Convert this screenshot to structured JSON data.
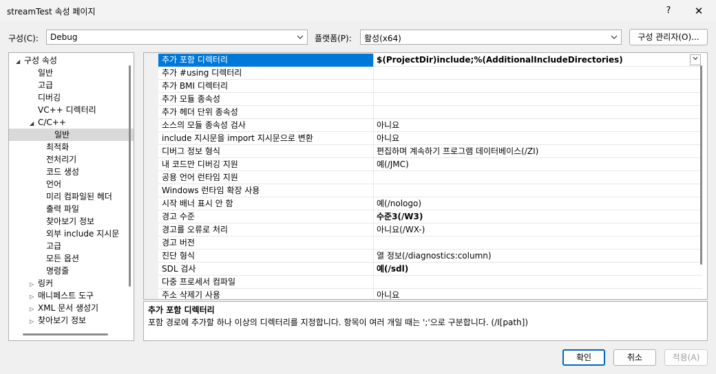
{
  "window": {
    "title": "streamTest 속성 페이지",
    "help": "?",
    "close": "✕"
  },
  "toolbar": {
    "config_label": "구성(C):",
    "config_value": "Debug",
    "platform_label": "플랫폼(P):",
    "platform_value": "활성(x64)",
    "config_manager": "구성 관리자(O)..."
  },
  "tree": [
    {
      "label": "구성 속성",
      "level": 0,
      "toggle": "expanded"
    },
    {
      "label": "일반",
      "level": 1
    },
    {
      "label": "고급",
      "level": 1
    },
    {
      "label": "디버깅",
      "level": 1
    },
    {
      "label": "VC++ 디렉터리",
      "level": 1
    },
    {
      "label": "C/C++",
      "level": 1,
      "toggle": "expanded"
    },
    {
      "label": "일반",
      "level": 2,
      "selected": true
    },
    {
      "label": "최적화",
      "level": 2
    },
    {
      "label": "전처리기",
      "level": 2
    },
    {
      "label": "코드 생성",
      "level": 2
    },
    {
      "label": "언어",
      "level": 2
    },
    {
      "label": "미리 컴파일된 헤더",
      "level": 2
    },
    {
      "label": "출력 파일",
      "level": 2
    },
    {
      "label": "찾아보기 정보",
      "level": 2
    },
    {
      "label": "외부 include 지시문",
      "level": 2
    },
    {
      "label": "고급",
      "level": 2
    },
    {
      "label": "모든 옵션",
      "level": 2
    },
    {
      "label": "명령줄",
      "level": 2
    },
    {
      "label": "링커",
      "level": 1,
      "toggle": "collapsed"
    },
    {
      "label": "매니페스트 도구",
      "level": 1,
      "toggle": "collapsed"
    },
    {
      "label": "XML 문서 생성기",
      "level": 1,
      "toggle": "collapsed"
    },
    {
      "label": "찾아보기 정보",
      "level": 1,
      "toggle": "collapsed"
    }
  ],
  "properties": [
    {
      "name": "추가 포함 디렉터리",
      "value": "$(ProjectDir)include;%(AdditionalIncludeDirectories)",
      "bold": true,
      "selected": true
    },
    {
      "name": "추가 #using 디렉터리",
      "value": ""
    },
    {
      "name": "추가 BMI 디렉터리",
      "value": ""
    },
    {
      "name": "추가 모듈 종속성",
      "value": ""
    },
    {
      "name": "추가 헤더 단위 종속성",
      "value": ""
    },
    {
      "name": "소스의 모듈 종속성 검사",
      "value": "아니요"
    },
    {
      "name": "include 지시문을 import 지시문으로 변환",
      "value": "아니요"
    },
    {
      "name": "디버그 정보 형식",
      "value": "편집하며 계속하기 프로그램 데이터베이스(/ZI)"
    },
    {
      "name": "내 코드만 디버깅 지원",
      "value": "예(/JMC)"
    },
    {
      "name": "공용 언어 런타임 지원",
      "value": ""
    },
    {
      "name": "Windows 런타임 확장 사용",
      "value": ""
    },
    {
      "name": "시작 배너 표시 안 함",
      "value": "예(/nologo)"
    },
    {
      "name": "경고 수준",
      "value": "수준3(/W3)",
      "bold": true
    },
    {
      "name": "경고를 오류로 처리",
      "value": "아니요(/WX-)"
    },
    {
      "name": "경고 버전",
      "value": ""
    },
    {
      "name": "진단 형식",
      "value": "열 정보(/diagnostics:column)"
    },
    {
      "name": "SDL 검사",
      "value": "예(/sdl)",
      "bold": true
    },
    {
      "name": "다중 프로세서 컴파일",
      "value": ""
    },
    {
      "name": "주소 삭제기 사용",
      "value": "아니요"
    }
  ],
  "description": {
    "title": "추가 포함 디렉터리",
    "text": "포함 경로에 추가할 하나 이상의 디렉터리를 지정합니다. 항목이 여러 개일 때는 ';'으로 구분합니다. (/I[path])"
  },
  "buttons": {
    "ok": "확인",
    "cancel": "취소",
    "apply": "적용(A)"
  },
  "icons": {
    "combo_arrow": "chevron-down-icon",
    "tree_expanded": "triangle-down-icon",
    "tree_collapsed": "triangle-right-icon"
  }
}
